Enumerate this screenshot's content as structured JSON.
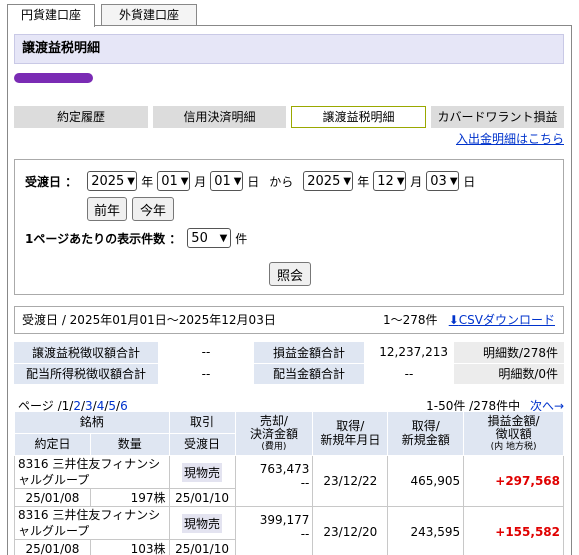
{
  "tabs": {
    "yen": "円貨建口座",
    "foreign": "外貨建口座"
  },
  "page_title": "譲渡益税明細",
  "subnav": [
    "約定履歴",
    "信用決済明細",
    "譲渡益税明細",
    "カバードワラント損益"
  ],
  "deposit_link": "入出金明細はこちら",
  "search": {
    "label_date": "受渡日 ：",
    "from": {
      "year": "2025",
      "month": "01",
      "day": "01"
    },
    "to": {
      "year": "2025",
      "month": "12",
      "day": "03"
    },
    "unit_year": "年",
    "unit_month": "月",
    "unit_day": "日",
    "kara": "から",
    "btn_prev_year": "前年",
    "btn_this_year": "今年",
    "per_page_label": "1ページあたりの表示件数 ：",
    "per_page_value": "50",
    "per_page_unit": "件",
    "btn_query": "照会"
  },
  "range": {
    "text": "受渡日 / 2025年01月01日～2025年12月03日",
    "count": "1～278件",
    "csv": "CSVダウンロード"
  },
  "summary": {
    "row1": {
      "h1": "譲渡益税徴収額合計",
      "v1": "--",
      "h2": "損益金額合計",
      "v2": "12,237,213",
      "count": "明細数/278件"
    },
    "row2": {
      "h1": "配当所得税徴収額合計",
      "v1": "--",
      "h2": "配当金額合計",
      "v2": "--",
      "count": "明細数/0件"
    }
  },
  "pager": {
    "prefix": "ページ /",
    "current": "1",
    "sep": "/",
    "pages": [
      "2",
      "3",
      "4",
      "5",
      "6"
    ],
    "info": "1-50件 /278件中",
    "next": "次へ→"
  },
  "table": {
    "h_brand": "銘柄",
    "h_trade": "取引",
    "h_sell_1": "売却/",
    "h_sell_2": "決済金額",
    "h_sell_3": "(費用)",
    "h_acq_date_1": "取得/",
    "h_acq_date_2": "新規年月日",
    "h_acq_amt_1": "取得/",
    "h_acq_amt_2": "新規金額",
    "h_pl_1": "損益金額/",
    "h_pl_2": "徴収額",
    "h_pl_3": "(内 地方税)",
    "h_contract_date": "約定日",
    "h_qty": "数量",
    "h_delivery_date": "受渡日",
    "rows": [
      {
        "brand": "8316 三井住友フィナンシャルグループ",
        "trade": "現物売",
        "sell": "763,473",
        "cost": "--",
        "acq_date": "23/12/22",
        "acq_amt": "465,905",
        "pl": "+297,568",
        "contract_date": "25/01/08",
        "qty": "197株",
        "delivery_date": "25/01/10"
      },
      {
        "brand": "8316 三井住友フィナンシャルグループ",
        "trade": "現物売",
        "sell": "399,177",
        "cost": "--",
        "acq_date": "23/12/20",
        "acq_amt": "243,595",
        "pl": "+155,582",
        "contract_date": "25/01/08",
        "qty": "103株",
        "delivery_date": "25/01/10"
      }
    ]
  }
}
